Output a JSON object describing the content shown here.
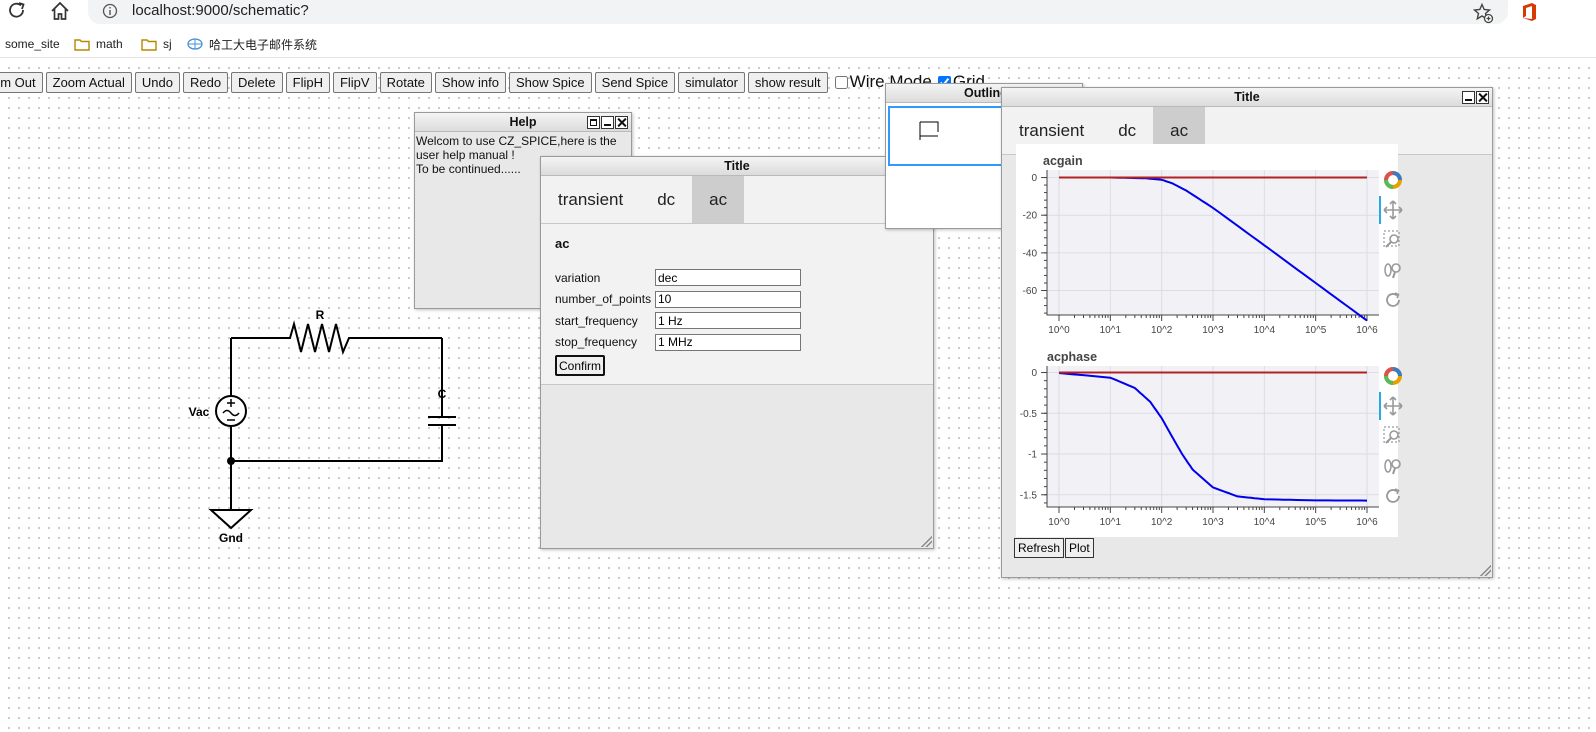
{
  "browser": {
    "url": "localhost:9000/schematic?",
    "bookmarks": [
      "some_site",
      "math",
      "sj",
      "哈工大电子邮件系统"
    ]
  },
  "toolbar": {
    "buttons": [
      "om Out",
      "Zoom Actual",
      "Undo",
      "Redo",
      "Delete",
      "FlipH",
      "FlipV",
      "Rotate",
      "Show info",
      "Show Spice",
      "Send Spice",
      "simulator",
      "show result"
    ],
    "wire_mode": {
      "label": "Wire Mode",
      "checked": false
    },
    "grid": {
      "label": "Grid",
      "checked": true
    }
  },
  "schematic": {
    "resistor_label": "R",
    "capacitor_label": "C",
    "source_label": "Vac",
    "ground_label": "Gnd"
  },
  "help_window": {
    "title": "Help",
    "text_line1": "Welcom to use CZ_SPICE,here is the",
    "text_line2": "user help manual !",
    "text_line3": "To be continued......"
  },
  "outline_window": {
    "title": "Outline"
  },
  "ac_window": {
    "title": "Title",
    "tabs": [
      "transient",
      "dc",
      "ac"
    ],
    "active_tab": "ac",
    "section_title": "ac",
    "fields": [
      {
        "label": "variation",
        "value": "dec"
      },
      {
        "label": "number_of_points",
        "value": "10"
      },
      {
        "label": "start_frequency",
        "value": "1 Hz"
      },
      {
        "label": "stop_frequency",
        "value": "1 MHz"
      }
    ],
    "confirm_label": "Confirm"
  },
  "result_window": {
    "title": "Title",
    "tabs": [
      "transient",
      "dc",
      "ac"
    ],
    "active_tab": "ac",
    "refresh_label": "Refresh",
    "plot_label": "Plot"
  },
  "chart_data": [
    {
      "type": "line",
      "title": "acgain",
      "x_scale": "log",
      "x_tick_labels": [
        "10^0",
        "10^1",
        "10^2",
        "10^3",
        "10^4",
        "10^5",
        "10^6"
      ],
      "y_ticks": [
        0,
        -20,
        -40,
        -60
      ],
      "xlim": [
        1,
        1000000
      ],
      "ylim": [
        -73,
        4
      ],
      "series": [
        {
          "color": "#0000ee",
          "x": [
            1,
            10,
            50,
            100,
            159,
            300,
            1000,
            10000,
            100000,
            1000000
          ],
          "y": [
            0,
            0,
            -0.4,
            -1.2,
            -3,
            -6.9,
            -16.1,
            -36,
            -56,
            -76
          ]
        },
        {
          "color": "#b22222",
          "x": [
            1,
            1000000
          ],
          "y": [
            0,
            0
          ]
        }
      ]
    },
    {
      "type": "line",
      "title": "acphase",
      "x_scale": "log",
      "x_tick_labels": [
        "10^0",
        "10^1",
        "10^2",
        "10^3",
        "10^4",
        "10^5",
        "10^6"
      ],
      "y_ticks": [
        0,
        -0.5,
        -1,
        -1.5
      ],
      "xlim": [
        1,
        1000000
      ],
      "ylim": [
        -1.65,
        0.08
      ],
      "series": [
        {
          "color": "#0000ee",
          "x": [
            1,
            10,
            30,
            60,
            100,
            159,
            250,
            400,
            1000,
            3000,
            10000,
            100000,
            1000000
          ],
          "y": [
            -0.006,
            -0.063,
            -0.19,
            -0.36,
            -0.56,
            -0.785,
            -1.0,
            -1.19,
            -1.41,
            -1.52,
            -1.555,
            -1.569,
            -1.571
          ]
        },
        {
          "color": "#b22222",
          "x": [
            1,
            1000000
          ],
          "y": [
            0,
            0
          ]
        }
      ]
    }
  ]
}
